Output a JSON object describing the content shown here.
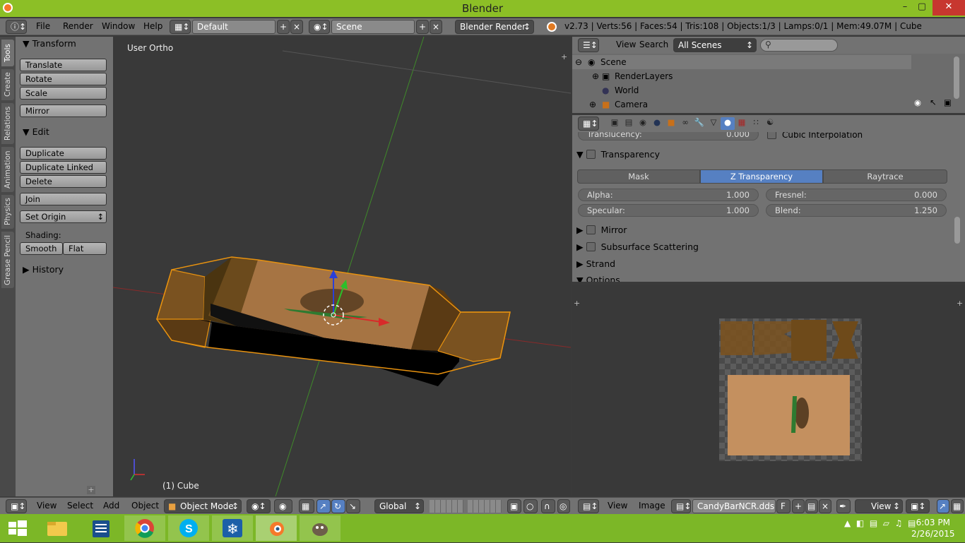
{
  "window": {
    "title": "Blender",
    "min": "–",
    "max": "▢",
    "close": "✕"
  },
  "header": {
    "menus": [
      "File",
      "Render",
      "Window",
      "Help"
    ],
    "layout": "Default",
    "scene": "Scene",
    "engine": "Blender Render",
    "stats": "v2.73 | Verts:56 | Faces:54 | Tris:108 | Objects:1/3 | Lamps:0/1 | Mem:49.07M | Cube"
  },
  "vtabs": [
    "Tools",
    "Create",
    "Relations",
    "Animation",
    "Physics",
    "Grease Pencil"
  ],
  "tools": {
    "transform_header": "Transform",
    "translate": "Translate",
    "rotate": "Rotate",
    "scale": "Scale",
    "mirror": "Mirror",
    "edit_header": "Edit",
    "duplicate": "Duplicate",
    "duplicate_linked": "Duplicate Linked",
    "delete": "Delete",
    "join": "Join",
    "set_origin": "Set Origin",
    "shading_label": "Shading:",
    "smooth": "Smooth",
    "flat": "Flat",
    "history_header": "History"
  },
  "viewport": {
    "view_label": "User Ortho",
    "object_label": "(1) Cube"
  },
  "outliner": {
    "menus": [
      "View",
      "Search"
    ],
    "scenes_select": "All Scenes",
    "rows": [
      "Scene",
      "RenderLayers",
      "World",
      "Camera"
    ]
  },
  "properties": {
    "translucency_label": "Translucency:",
    "translucency_value": "0.000",
    "cubic_interpolation": "Cubic Interpolation",
    "transparency": "Transparency",
    "modes": [
      "Mask",
      "Z Transparency",
      "Raytrace"
    ],
    "alpha_label": "Alpha:",
    "alpha_value": "1.000",
    "fresnel_label": "Fresnel:",
    "fresnel_value": "0.000",
    "specular_label": "Specular:",
    "specular_value": "1.000",
    "blend_label": "Blend:",
    "blend_value": "1.250",
    "mirror": "Mirror",
    "sss": "Subsurface Scattering",
    "strand": "Strand",
    "options": "Options"
  },
  "bottombar": {
    "view_menus": [
      "View",
      "Select",
      "Add",
      "Object"
    ],
    "mode": "Object Mode",
    "orientation": "Global",
    "img_menus": [
      "View",
      "Image"
    ],
    "image_name": "CandyBarNCR.dds",
    "fake_user": "F",
    "img_view": "View"
  },
  "taskbar": {
    "time": "6:03 PM",
    "date": "2/26/2015"
  },
  "colors": {
    "accent": "#5680c2",
    "window_green": "#8cbf26",
    "selection": "#f5a623"
  }
}
